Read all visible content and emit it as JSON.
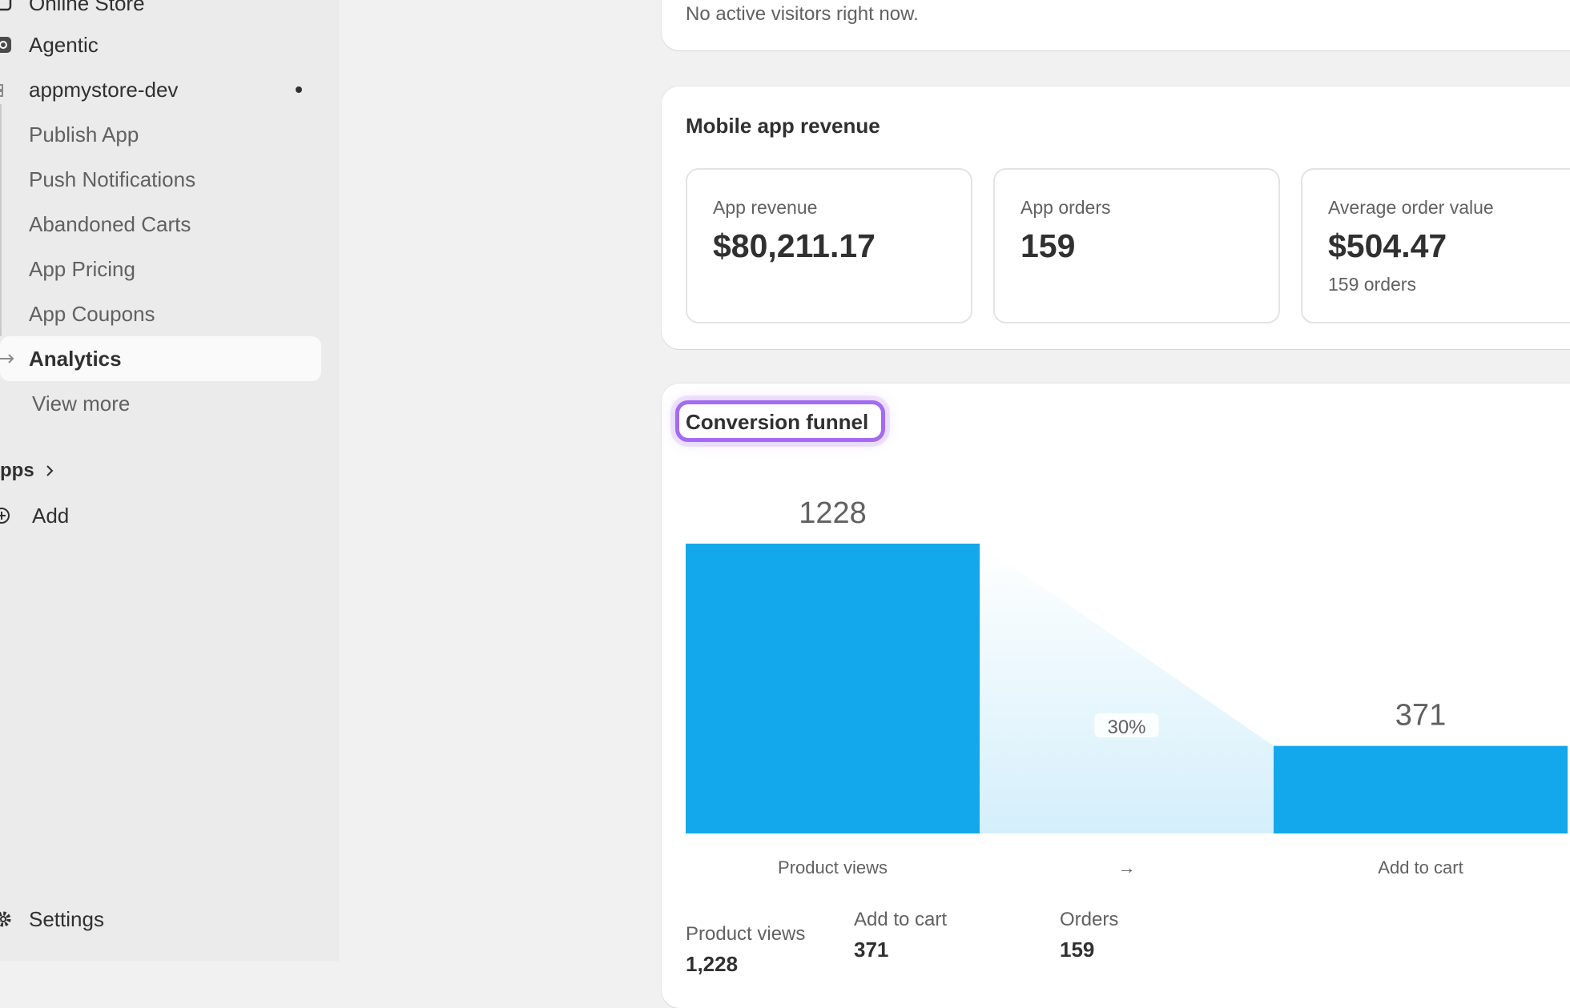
{
  "sidebar": {
    "online_store": "Online Store",
    "agentic": "Agentic",
    "app_group": "appmystore-dev",
    "items": [
      {
        "label": "Publish App"
      },
      {
        "label": "Push Notifications"
      },
      {
        "label": "Abandoned Carts"
      },
      {
        "label": "App Pricing"
      },
      {
        "label": "App Coupons"
      },
      {
        "label": "Analytics"
      }
    ],
    "view_more": "View more",
    "apps_header": "pps",
    "add": "Add",
    "settings": "Settings"
  },
  "visitors": {
    "text": "No active visitors right now."
  },
  "revenue": {
    "title": "Mobile app revenue",
    "metrics": [
      {
        "label": "App revenue",
        "value": "$80,211.17",
        "sub": ""
      },
      {
        "label": "App orders",
        "value": "159",
        "sub": ""
      },
      {
        "label": "Average order value",
        "value": "$504.47",
        "sub": "159 orders"
      }
    ]
  },
  "funnel": {
    "title": "Conversion funnel",
    "arrow": "→",
    "conversion_label": "30%",
    "summary": [
      {
        "label": "Product views",
        "value": "1,228"
      },
      {
        "label": "Add to cart",
        "value": "371"
      },
      {
        "label": "Orders",
        "value": "159"
      }
    ]
  },
  "chart_data": {
    "type": "bar",
    "categories": [
      "Product views",
      "Add to cart"
    ],
    "values": [
      1228,
      371
    ],
    "conversion_rates": [
      "30%"
    ],
    "colors": {
      "bar": "#13a8eb",
      "flow": "#d4effb"
    },
    "ylim": [
      0,
      1228
    ]
  }
}
